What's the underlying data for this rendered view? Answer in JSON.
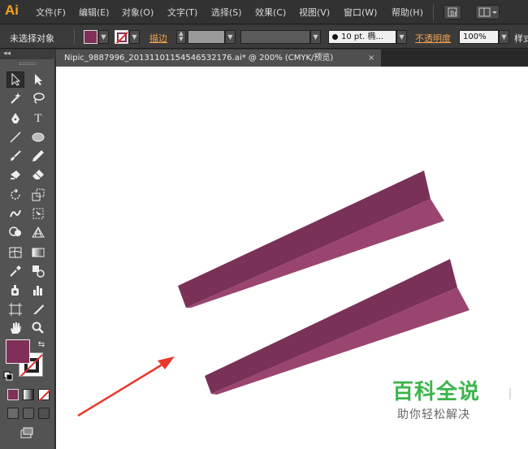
{
  "app": {
    "logo": "Ai"
  },
  "menu": [
    "文件(F)",
    "编辑(E)",
    "对象(O)",
    "文字(T)",
    "选择(S)",
    "效果(C)",
    "视图(V)",
    "窗口(W)",
    "帮助(H)"
  ],
  "control_bar": {
    "selection_status": "未选择对象",
    "stroke_label": "描边",
    "brush_value": "10 pt. 椭...",
    "opacity_label": "不透明度",
    "opacity_value": "100%",
    "style_label": "样式"
  },
  "tool_panel": {
    "collapse": "◂◂"
  },
  "document_tab": {
    "title": "Nipic_9887996_20131101154546532176.ai* @ 200% (CMYK/预览)",
    "close": "×"
  },
  "colors": {
    "fill": "#7f2f58",
    "shape_dark": "#7a3158",
    "shape_light": "#99456f",
    "arrow": "#e8372c",
    "watermark_green": "#3cb54a"
  },
  "watermark": {
    "title": "百科全说",
    "subtitle": "助你轻松解决"
  }
}
